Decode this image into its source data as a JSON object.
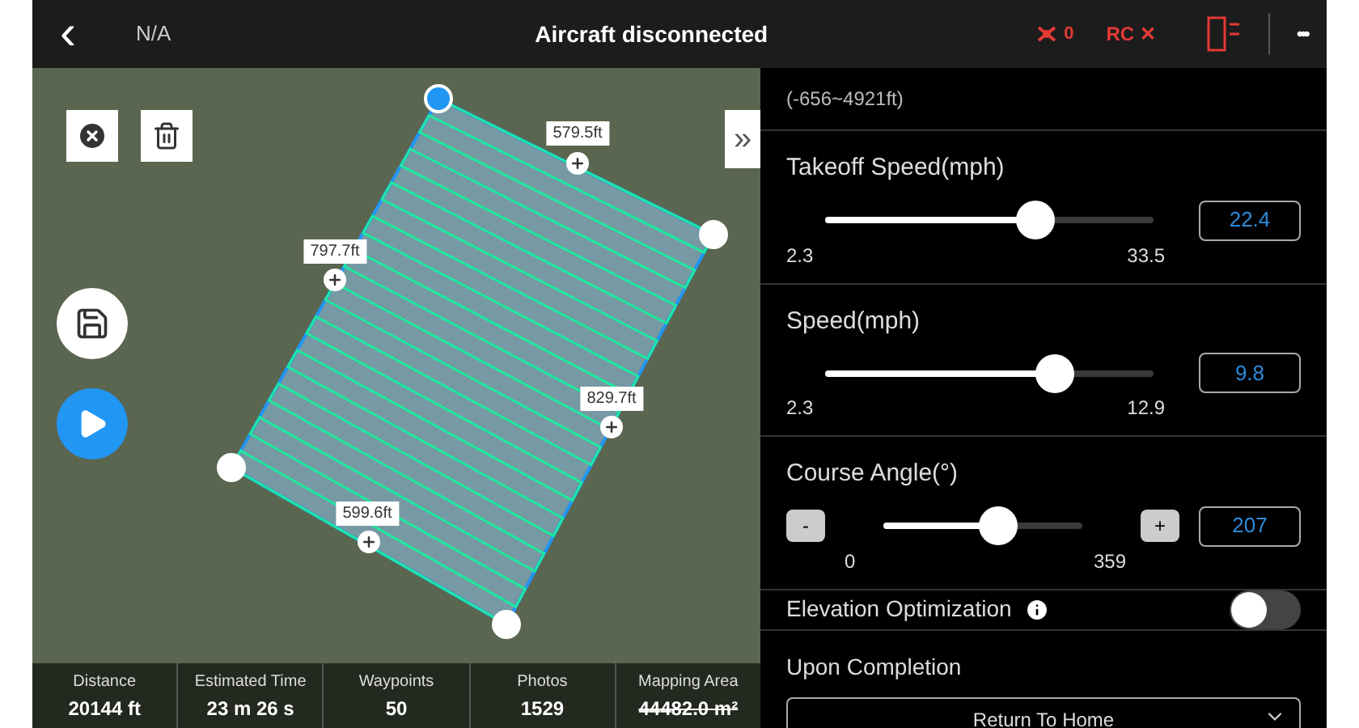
{
  "top_bar": {
    "back": "‹",
    "signal": "N/A",
    "title": "Aircraft disconnected",
    "aircraft_count": "0",
    "rc_status": "RC ✕",
    "more": "•••"
  },
  "map": {
    "edges": [
      {
        "label": "579.5ft"
      },
      {
        "label": "797.7ft"
      },
      {
        "label": "829.7ft"
      },
      {
        "label": "599.6ft"
      }
    ],
    "collapse": "»"
  },
  "stats": [
    {
      "label": "Distance",
      "value": "20144 ft",
      "struck": false
    },
    {
      "label": "Estimated Time",
      "value": "23 m 26 s",
      "struck": false
    },
    {
      "label": "Waypoints",
      "value": "50",
      "struck": false
    },
    {
      "label": "Photos",
      "value": "1529",
      "struck": false
    },
    {
      "label": "Mapping Area",
      "value": "44482.0 m²",
      "struck": true
    }
  ],
  "panel": {
    "range": "(-656~4921ft)",
    "sliders": [
      {
        "kind": "plain",
        "label": "Takeoff Speed(mph)",
        "level": 0.64,
        "min": "2.3",
        "max": "33.5",
        "value": "22.4"
      },
      {
        "kind": "plain",
        "label": "Speed(mph)",
        "level": 0.7,
        "min": "2.3",
        "max": "12.9",
        "value": "9.8"
      },
      {
        "kind": "stepper",
        "label": "Course Angle(°)",
        "level": 0.58,
        "min": "0",
        "max": "359",
        "value": "207",
        "minus": "-",
        "plus": "+"
      }
    ],
    "elevation": {
      "label": "Elevation Optimization",
      "on": false
    },
    "completion": {
      "label": "Upon Completion",
      "value": "Return To Home"
    }
  }
}
